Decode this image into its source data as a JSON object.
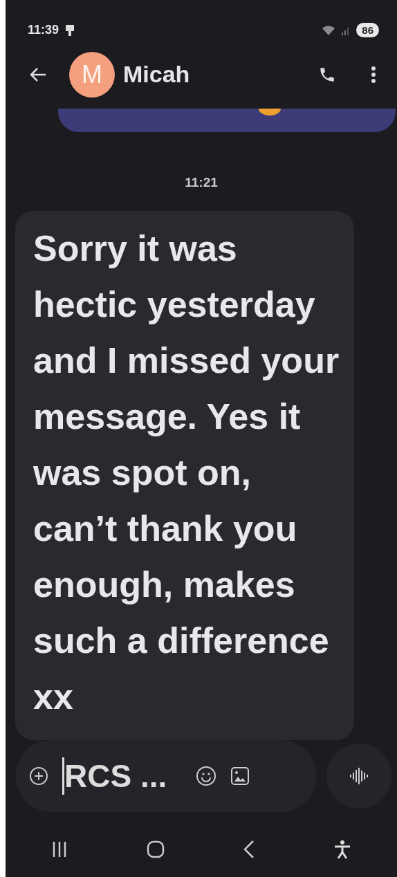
{
  "status_bar": {
    "time": "11:39",
    "battery": "86"
  },
  "header": {
    "avatar_letter": "M",
    "contact": "Micah"
  },
  "messages": [
    {
      "kind": "cut"
    },
    {
      "kind": "time",
      "text": "11:21"
    },
    {
      "kind": "incoming",
      "text": "Sorry it was hectic yesterday and I missed your message. Yes it was spot on, can’t thank you enough, makes such a difference xx"
    }
  ],
  "composer": {
    "placeholder": "RCS ..."
  }
}
